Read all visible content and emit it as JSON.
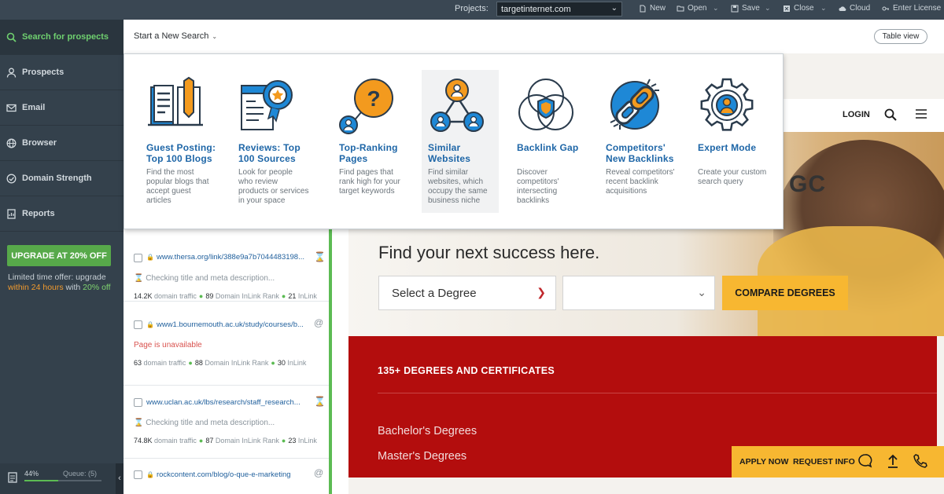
{
  "topbar": {
    "projects_label": "Projects:",
    "project_value": "targetinternet.com",
    "buttons": {
      "new": "New",
      "open": "Open",
      "save": "Save",
      "close": "Close",
      "cloud": "Cloud",
      "license": "Enter License"
    }
  },
  "sidebar": {
    "items": [
      {
        "label": "Search for prospects",
        "icon": "search-icon"
      },
      {
        "label": "Prospects",
        "icon": "user-icon"
      },
      {
        "label": "Email",
        "icon": "email-icon"
      },
      {
        "label": "Browser",
        "icon": "globe-icon"
      },
      {
        "label": "Domain Strength",
        "icon": "gauge-icon"
      },
      {
        "label": "Reports",
        "icon": "report-icon"
      }
    ],
    "upgrade_label": "UPGRADE AT 20% OFF",
    "offer": {
      "line1": "Limited time offer: upgrade",
      "within": "within 24 hours",
      "with": "with",
      "pct": "20% off"
    },
    "progress_pct_text": "44%",
    "progress_fraction": 0.44,
    "queue_text": "Queue: (5)",
    "collapse_glyph": "‹"
  },
  "search_head": {
    "new_search_label": "Start a New Search",
    "table_view_label": "Table view"
  },
  "modes": [
    {
      "title": "Guest Posting: Top 100 Blogs",
      "desc": "Find the most popular blogs that accept guest articles",
      "icon": "book-icon"
    },
    {
      "title": "Reviews: Top 100 Sources",
      "desc": "Look for people who review products or services in your space",
      "icon": "award-icon"
    },
    {
      "title": "Top-Ranking Pages",
      "desc": "Find pages that rank high for your target keywords",
      "icon": "question-bubble-icon"
    },
    {
      "title": "Similar Websites",
      "desc": "Find similar websites, which occupy the same business niche",
      "icon": "network-users-icon"
    },
    {
      "title": "Backlink Gap",
      "desc": "Discover competitors' intersecting backlinks",
      "icon": "venn-shield-icon"
    },
    {
      "title": "Competitors' New Backlinks",
      "desc": "Reveal competitors' recent backlink acquisitions",
      "icon": "chain-link-icon"
    },
    {
      "title": "Expert Mode",
      "desc": "Create your custom search query",
      "icon": "gear-user-icon"
    }
  ],
  "results": [
    {
      "url": "www.thersa.org/link/388e9a7b7044483198...",
      "status": "Checking title and meta description...",
      "status_type": "pending",
      "traffic": "14.2K",
      "traffic_label": "domain traffic",
      "dr": "89",
      "dr_label": "Domain InLink Rank",
      "extra": "21",
      "extra_label": "InLink",
      "status_icon": "hourglass-icon"
    },
    {
      "url": "www1.bournemouth.ac.uk/study/courses/b...",
      "status": "Page is unavailable",
      "status_type": "error",
      "traffic": "63",
      "traffic_label": "domain traffic",
      "dr": "88",
      "dr_label": "Domain InLink Rank",
      "extra": "30",
      "extra_label": "InLink",
      "status_icon": "at-icon"
    },
    {
      "url": "www.uclan.ac.uk/lbs/research/staff_research...",
      "status": "Checking title and meta description...",
      "status_type": "pending",
      "traffic": "74.8K",
      "traffic_label": "domain traffic",
      "dr": "87",
      "dr_label": "Domain InLink Rank",
      "extra": "23",
      "extra_label": "InLink",
      "status_icon": "hourglass-icon"
    },
    {
      "url": "rockcontent.com/blog/o-que-e-marketing",
      "status_icon": "at-icon"
    }
  ],
  "browser": {
    "login": "LOGIN",
    "brand_partial": "GC",
    "hero_title": "Find your next success here.",
    "select_degree": "Select a Degree",
    "compare_btn": "COMPARE DEGREES",
    "degrees_heading": "135+ DEGREES AND CERTIFICATES",
    "degree_links": [
      "Bachelor's Degrees",
      "Master's Degrees"
    ],
    "apply_now": "APPLY NOW",
    "request_info": "REQUEST INFO"
  },
  "colors": {
    "accent_green": "#5cbb53",
    "link_blue": "#1e66a7",
    "icon_orange": "#f39a1e",
    "site_red": "#b30d0d",
    "site_yellow": "#f7b731"
  }
}
